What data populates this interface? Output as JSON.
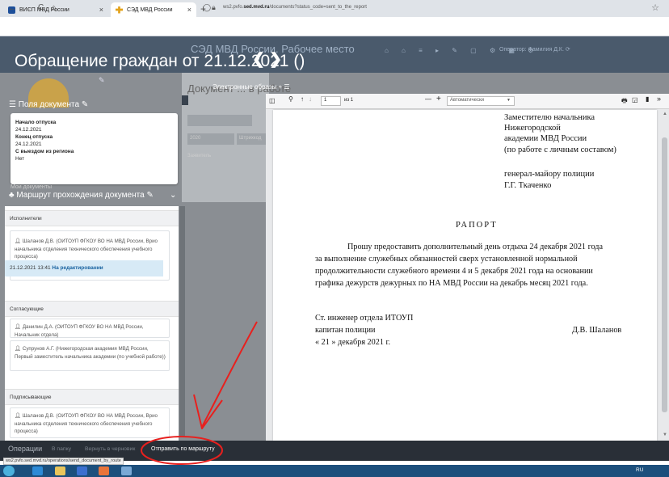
{
  "browser": {
    "tabs": [
      {
        "label": "ВИСП МВД России",
        "favicon_color": "#1d4f9a"
      },
      {
        "label": "СЭД МВД России",
        "favicon_color": "#e3a21a"
      }
    ],
    "new_tab_glyph": "+",
    "close_glyph": "×",
    "url": {
      "prefix": "ws2.pvfo.",
      "domain": "sed.mvd.ru",
      "path": "/documents?status_code=sent_to_the_report"
    },
    "nav": {
      "back": "←",
      "forward": "→",
      "reload": "C",
      "home": "⌂"
    }
  },
  "header": {
    "background_title": "СЭД МВД России. Рабочее место",
    "main_title": "Обращение граждан от 21.12.2021 ()",
    "arrows": "❮ ❯",
    "toolbar_icons": "⌂ ⌂ ≡ ▸ ✎ ▢ ⚙ ▦ ⚙",
    "user_text": "Оператор: Фамилия Д.К. ⟳"
  },
  "left": {
    "fields_title": "Поля документа",
    "fields": [
      {
        "label": "Начало отпуска",
        "value": "24.12.2021"
      },
      {
        "label": "Конец отпуска",
        "value": "24.12.2021"
      },
      {
        "label": "С выездом из региона",
        "value": "Нет"
      }
    ],
    "my_docs": "Мои документы",
    "route_title": "Маршрут прохождения документа",
    "sections": {
      "executors": "Исполнители",
      "approvers": "Согласующие",
      "signers": "Подписывающие"
    },
    "executor": "Шаланов Д.В. (ОИТОУП ФГКОУ ВО НА МВД России, Врио начальника отделения технического обеспечения учебного процесса)",
    "executor_status": {
      "time": "21.12.2021 13:41",
      "state": "На редактировании"
    },
    "approver1": "Данилин Д.А. (ОИТОУП ФГКОУ ВО НА МВД России, Начальник отдела)",
    "approver2": "Супрунов А.Г. (Нижегородская академия МВД России, Первый заместитель начальника академии (по учебной работе))",
    "signer": "Шаланов Д.В. (ОИТОУП ФГКОУ ВО НА МВД России, Врио начальника отделения технического обеспечения учебного процесса)"
  },
  "dim": {
    "doc_header": "Документ ... в работе",
    "images_label": "Электронные образы",
    "field1": "",
    "field2": "2020",
    "field3": "Штрихкод",
    "text": "Заявитель"
  },
  "pdf": {
    "page_current": "1",
    "page_total": "из 1",
    "zoom": "Автоматически",
    "minus": "—",
    "plus": "+",
    "addressee": [
      "Заместителю начальника",
      "Нижегородской",
      "академии МВД России",
      "(по работе с личным составом)",
      "",
      "генерал-майору полиции",
      "Г.Г. Ткаченко"
    ],
    "doc_type": "РАПОРТ",
    "body_lines": [
      "Прошу предоставить дополнительный день отдыха 24 декабря 2021 года",
      "за выполнение служебных обязанностей сверх установленной нормальной",
      "продолжительности служебного времени 4 и 5 декабря 2021 года на основании",
      "графика дежурств дежурных по НА МВД России на декабрь месяц 2021 года."
    ],
    "sign_lines": [
      "Ст. инженер отдела ИТОУП",
      "капитан полиции",
      "« 21 » декабря 2021 г."
    ],
    "signer_name": "Д.В. Шаланов"
  },
  "ops": {
    "label": "Операции",
    "archive": "В папку",
    "to_draft": "Вернуть в черновик",
    "send": "Отправить по маршруту",
    "status_url": "ws2.pvfo.sed.mvd.ru/operations/send_document_by_route"
  },
  "taskbar": {
    "lang": "RU"
  },
  "colors": {
    "header": "#4a5a6c",
    "annotation": "#e8201e",
    "status_strip": "#d7eaf6",
    "ops_bar": "#292f37",
    "taskbar": "#1c4f7c"
  }
}
